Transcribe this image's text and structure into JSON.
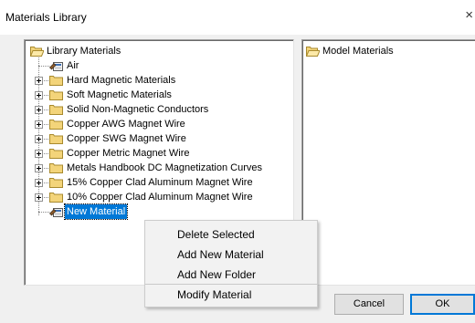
{
  "window": {
    "title": "Materials Library",
    "close_glyph": "×"
  },
  "library_tree": {
    "root_label": "Library Materials",
    "items": [
      {
        "label": "Air",
        "type": "material",
        "expandable": false
      },
      {
        "label": "Hard Magnetic Materials",
        "type": "folder",
        "expandable": true
      },
      {
        "label": "Soft Magnetic Materials",
        "type": "folder",
        "expandable": true
      },
      {
        "label": "Solid Non-Magnetic Conductors",
        "type": "folder",
        "expandable": true
      },
      {
        "label": "Copper AWG Magnet Wire",
        "type": "folder",
        "expandable": true
      },
      {
        "label": "Copper SWG Magnet Wire",
        "type": "folder",
        "expandable": true
      },
      {
        "label": "Copper Metric Magnet Wire",
        "type": "folder",
        "expandable": true
      },
      {
        "label": "Metals Handbook DC Magnetization Curves",
        "type": "folder",
        "expandable": true
      },
      {
        "label": "15% Copper Clad Aluminum Magnet Wire",
        "type": "folder",
        "expandable": true
      },
      {
        "label": "10% Copper Clad Aluminum Magnet Wire",
        "type": "folder",
        "expandable": true
      },
      {
        "label": "New Material",
        "type": "material",
        "expandable": false,
        "selected": true
      }
    ]
  },
  "model_tree": {
    "root_label": "Model Materials"
  },
  "context_menu": {
    "items": [
      {
        "label": "Delete Selected"
      },
      {
        "label": "Add New Material"
      },
      {
        "label": "Add New Folder"
      },
      {
        "label": "Modify Material"
      }
    ]
  },
  "buttons": {
    "cancel_label": "Cancel",
    "ok_label": "OK"
  },
  "colors": {
    "selection": "#0078d7",
    "folder": "#f3d47a",
    "window_bg": "#f0f0f0"
  },
  "icons": {
    "folder": "folder-icon",
    "material": "material-icon",
    "expand": "plus-expander-icon"
  }
}
